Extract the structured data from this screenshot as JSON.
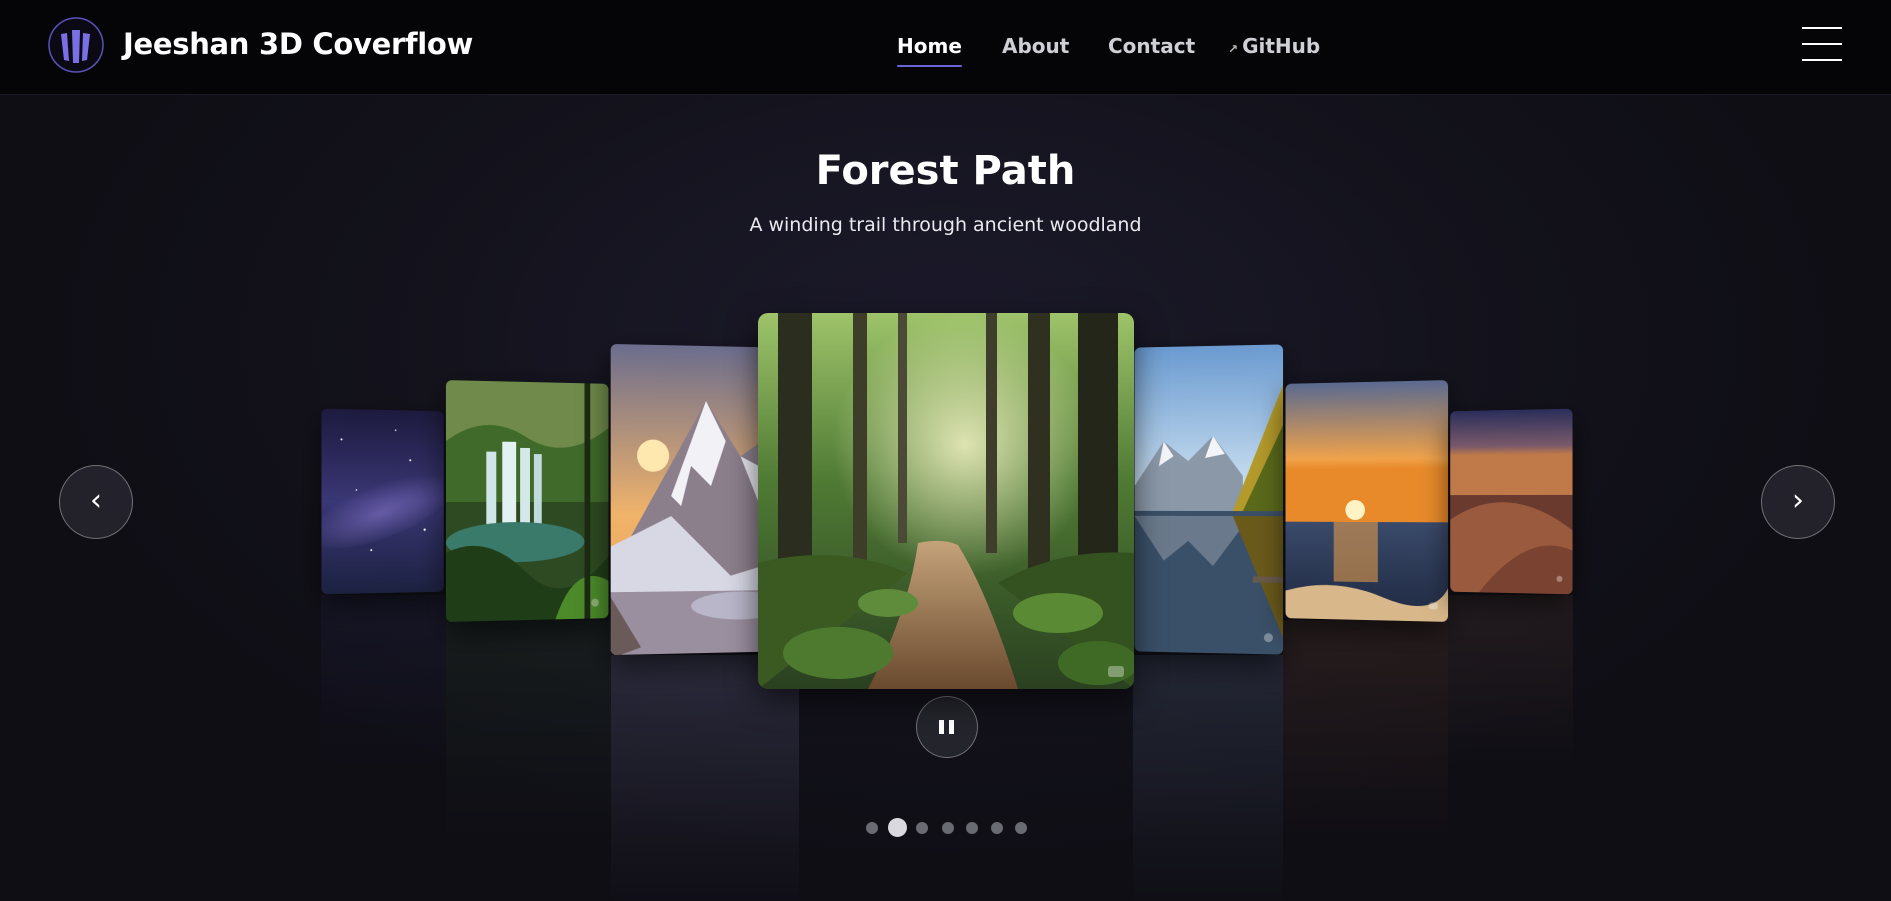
{
  "navbar": {
    "brand": "Jeeshan 3D Coverflow",
    "links": [
      {
        "label": "Home",
        "active": true
      },
      {
        "label": "About",
        "active": false
      },
      {
        "label": "Contact",
        "active": false
      },
      {
        "label": "GitHub",
        "active": false,
        "external": true
      }
    ],
    "accent_color": "#6d63d9",
    "menu_icon": "hamburger-menu-icon"
  },
  "slide": {
    "title": "Forest Path",
    "subtitle": "A winding trail through ancient woodland"
  },
  "carousel": {
    "cards": [
      {
        "scene": "milky-way",
        "position": "far-left"
      },
      {
        "scene": "waterfall",
        "position": "left-2"
      },
      {
        "scene": "snowy-mountain-sunset",
        "position": "left-1"
      },
      {
        "scene": "forest-path",
        "position": "center"
      },
      {
        "scene": "mountain-lake",
        "position": "right-1"
      },
      {
        "scene": "ocean-sunset",
        "position": "right-2"
      },
      {
        "scene": "desert-dunes",
        "position": "far-right"
      }
    ],
    "prev_label": "‹",
    "next_label": "›",
    "autoplay": "playing",
    "pause_icon": "pause-icon",
    "dot_count": 7,
    "active_dot": 2
  }
}
